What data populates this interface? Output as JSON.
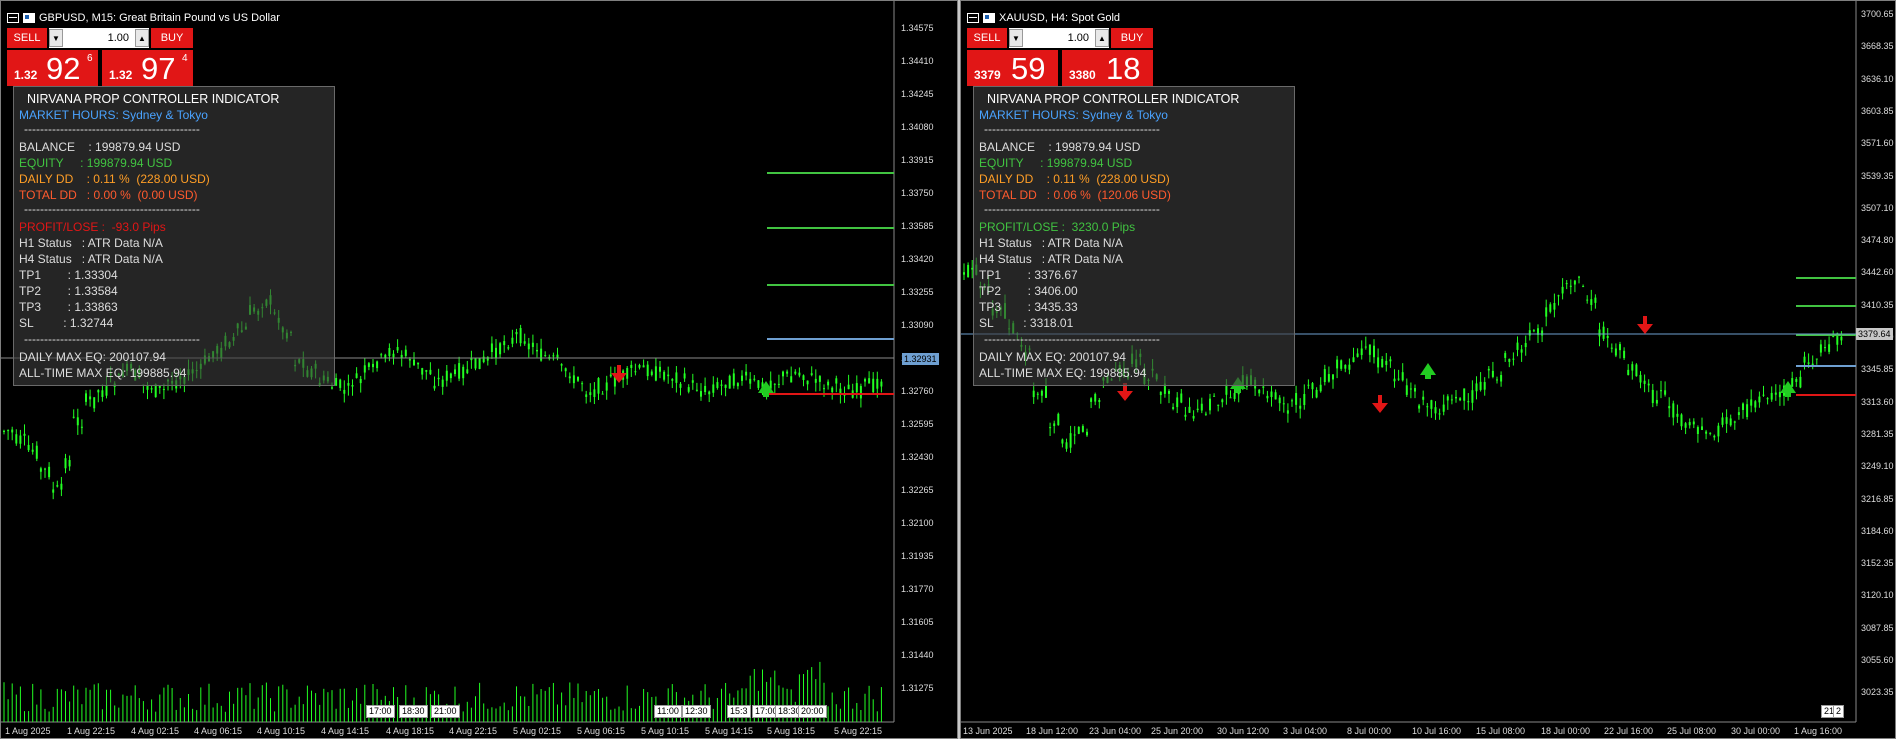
{
  "left": {
    "title": "GBPUSD, M15:  Great Britain Pound vs US Dollar",
    "trade": {
      "sell_label": "SELL",
      "buy_label": "BUY",
      "volume": "1.00",
      "bid_prefix": "1.32",
      "bid_big": "92",
      "bid_sup": "6",
      "ask_prefix": "1.32",
      "ask_big": "97",
      "ask_sup": "4"
    },
    "panel": {
      "header": "NIRVANA PROP CONTROLLER INDICATOR",
      "market_hours": "MARKET HOURS: Sydney & Tokyo",
      "sep": "--------------------------------------------",
      "balance": "BALANCE    : 199879.94 USD",
      "equity": "EQUITY     : 199879.94 USD",
      "daily_dd": "DAILY DD    : 0.11 %  (228.00 USD)",
      "total_dd": "TOTAL DD   : 0.00 %  (0.00 USD)",
      "profit": "PROFIT/LOSE :  -93.0 Pips",
      "h1": "H1 Status   : ATR Data N/A",
      "h4": "H4 Status   : ATR Data N/A",
      "tp1": "TP1        : 1.33304",
      "tp2": "TP2        : 1.33584",
      "tp3": "TP3        : 1.33863",
      "sl": "SL         : 1.32744",
      "daily_max": "DAILY MAX EQ: 200107.94",
      "alltime_max": "ALL-TIME MAX EQ: 199885.94"
    },
    "y_labels": [
      "1.34575",
      "1.34410",
      "1.34245",
      "1.34080",
      "1.33915",
      "1.33750",
      "1.33585",
      "1.33420",
      "1.33255",
      "1.33090",
      "1.32925",
      "1.32760",
      "1.32595",
      "1.32430",
      "1.32265",
      "1.32100",
      "1.31935",
      "1.31770",
      "1.31605",
      "1.31440",
      "1.31275"
    ],
    "current_price": "1.32931",
    "x_labels": [
      "1 Aug 2025",
      "1 Aug 22:15",
      "4 Aug 02:15",
      "4 Aug 06:15",
      "4 Aug 10:15",
      "4 Aug 14:15",
      "4 Aug 18:15",
      "4 Aug 22:15",
      "5 Aug 02:15",
      "5 Aug 06:15",
      "5 Aug 10:15",
      "5 Aug 14:15",
      "5 Aug 18:15",
      "5 Aug 22:15"
    ],
    "time_boxes": [
      "17:00",
      "18:30",
      "21:00",
      "11:00",
      "12:30",
      "15:3",
      "17:00",
      "18:30",
      "20:00"
    ]
  },
  "right": {
    "title": "XAUUSD, H4:  Spot Gold",
    "trade": {
      "sell_label": "SELL",
      "buy_label": "BUY",
      "volume": "1.00",
      "bid_prefix": "3379",
      "bid_big": "59",
      "bid_sup": "",
      "ask_prefix": "3380",
      "ask_big": "18",
      "ask_sup": ""
    },
    "panel": {
      "header": "NIRVANA PROP CONTROLLER INDICATOR",
      "market_hours": "MARKET HOURS: Sydney & Tokyo",
      "sep": "--------------------------------------------",
      "balance": "BALANCE    : 199879.94 USD",
      "equity": "EQUITY     : 199879.94 USD",
      "daily_dd": "DAILY DD    : 0.11 %  (228.00 USD)",
      "total_dd": "TOTAL DD   : 0.06 %  (120.06 USD)",
      "profit": "PROFIT/LOSE :  3230.0 Pips",
      "h1": "H1 Status   : ATR Data N/A",
      "h4": "H4 Status   : ATR Data N/A",
      "tp1": "TP1        : 3376.67",
      "tp2": "TP2        : 3406.00",
      "tp3": "TP3        : 3435.33",
      "sl": "SL         : 3318.01",
      "daily_max": "DAILY MAX EQ: 200107.94",
      "alltime_max": "ALL-TIME MAX EQ: 199885.94"
    },
    "y_labels": [
      "3700.65",
      "3668.35",
      "3636.10",
      "3603.85",
      "3571.60",
      "3539.35",
      "3507.10",
      "3474.80",
      "3442.60",
      "3410.35",
      "3378.10",
      "3345.85",
      "3313.60",
      "3281.35",
      "3249.10",
      "3216.85",
      "3184.60",
      "3152.35",
      "3120.10",
      "3087.85",
      "3055.60",
      "3023.35"
    ],
    "current_price": "3379.64",
    "x_labels": [
      "13 Jun 2025",
      "18 Jun 12:00",
      "23 Jun 04:00",
      "25 Jun 20:00",
      "30 Jun 12:00",
      "3 Jul 04:00",
      "8 Jul 00:00",
      "10 Jul 16:00",
      "15 Jul 08:00",
      "18 Jul 00:00",
      "22 Jul 16:00",
      "25 Jul 08:00",
      "30 Jul 00:00",
      "1 Aug 16:00"
    ],
    "time_boxes": [
      "21:",
      "2"
    ]
  },
  "colors": {
    "candle": "#22ff22",
    "tp": "#41c341",
    "sl": "#e11616",
    "profit_neg": "#e11616",
    "profit_pos": "#41c341",
    "hours": "#4aa3ff",
    "equity": "#41c341",
    "daily": "#ff9e26",
    "total": "#ff5a2e"
  }
}
